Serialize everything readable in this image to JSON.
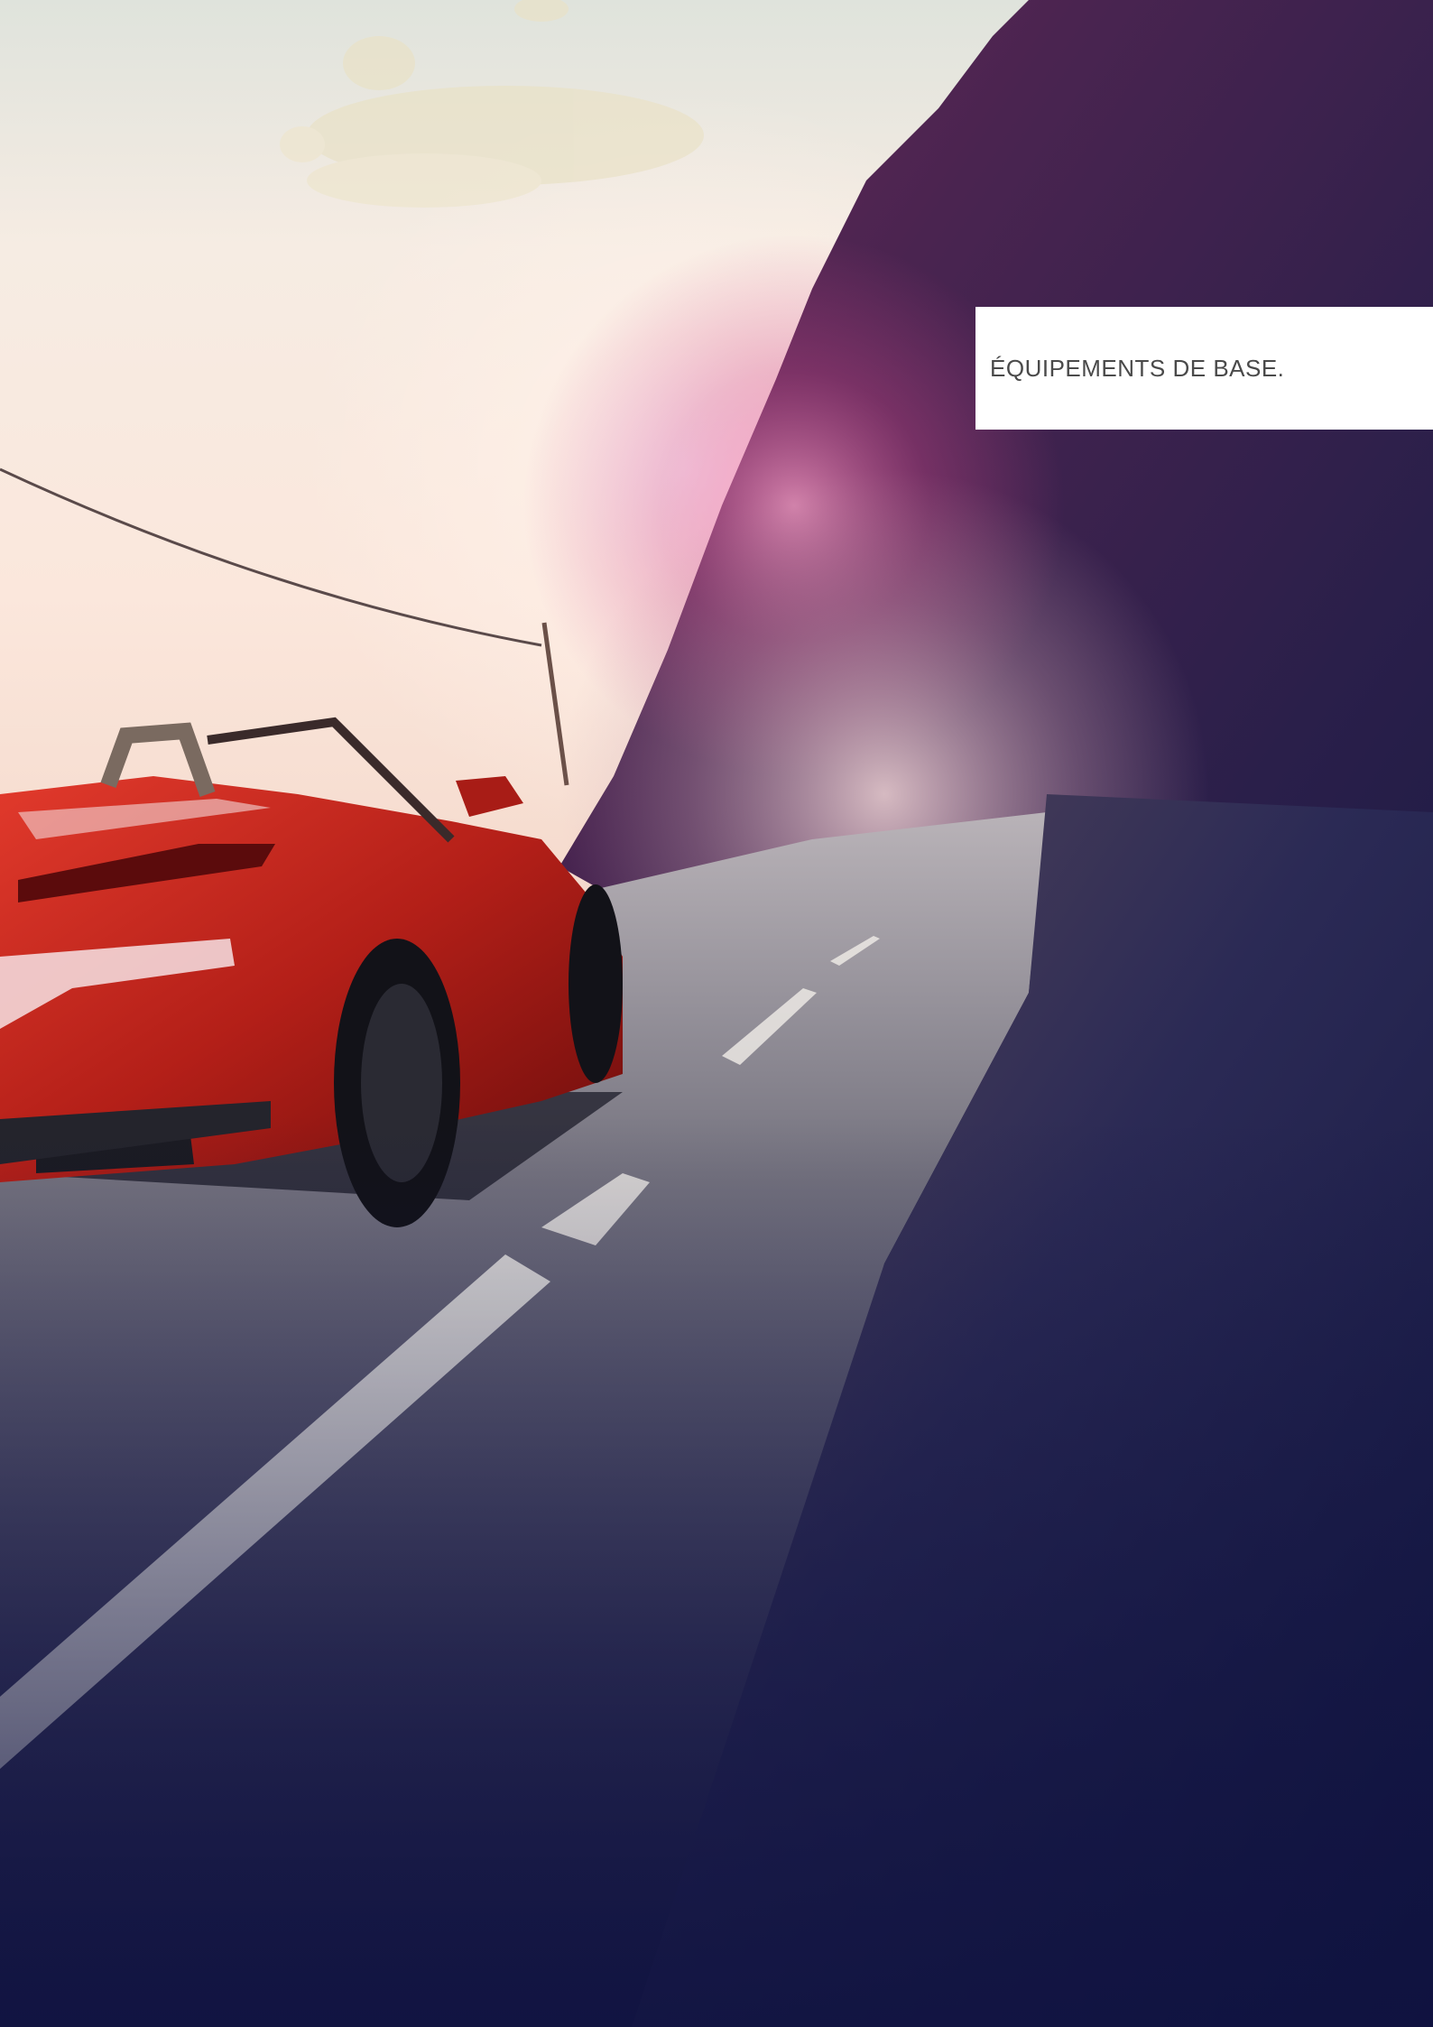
{
  "section": {
    "title": "ÉQUIPEMENTS DE BASE."
  },
  "colors": {
    "sky_top": "#dfe4df",
    "sky_warm": "#fbeadf",
    "cliff_dark": "#2a1c45",
    "cliff_magenta": "#8a2f6a",
    "road": "#6b6a78",
    "ground_dark": "#15183f",
    "car_red": "#c2261a",
    "title_box": "#ffffff",
    "title_text": "#4a4a4a"
  }
}
